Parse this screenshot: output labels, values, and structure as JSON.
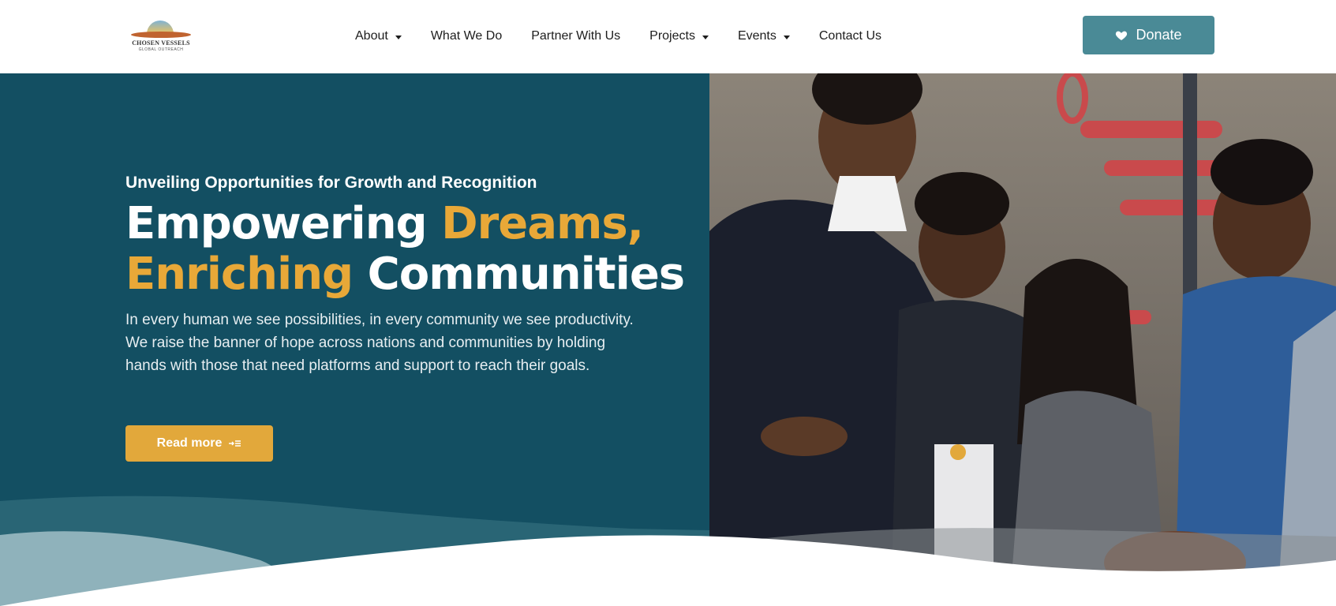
{
  "logo": {
    "name": "CHOSEN VESSELS",
    "tagline": "GLOBAL OUTREACH"
  },
  "nav": {
    "items": [
      {
        "label": "About",
        "has_dropdown": true
      },
      {
        "label": "What We Do",
        "has_dropdown": false
      },
      {
        "label": "Partner With Us",
        "has_dropdown": false
      },
      {
        "label": "Projects",
        "has_dropdown": true
      },
      {
        "label": "Events",
        "has_dropdown": true
      },
      {
        "label": "Contact Us",
        "has_dropdown": false
      }
    ],
    "donate_label": "Donate"
  },
  "hero": {
    "eyebrow": "Unveiling Opportunities for Growth and Recognition",
    "headline": {
      "line1_a": "Empowering ",
      "line1_b": "Dreams,",
      "line2_a": "Enriching",
      "line2_b": " Communities"
    },
    "description": "In every human we see possibilities, in every community we see productivity. We raise the banner of hope across nations and communities by holding hands with those that need platforms and support to reach their goals.",
    "cta_label": "Read more"
  },
  "colors": {
    "hero_bg": "#134f62",
    "accent": "#e8a838",
    "button": "#e2a83b",
    "donate": "#4a8a96"
  },
  "icons": {
    "donate": "heart-icon",
    "cta": "arrow-list-icon",
    "nav_dropdown": "caret-down-icon"
  }
}
